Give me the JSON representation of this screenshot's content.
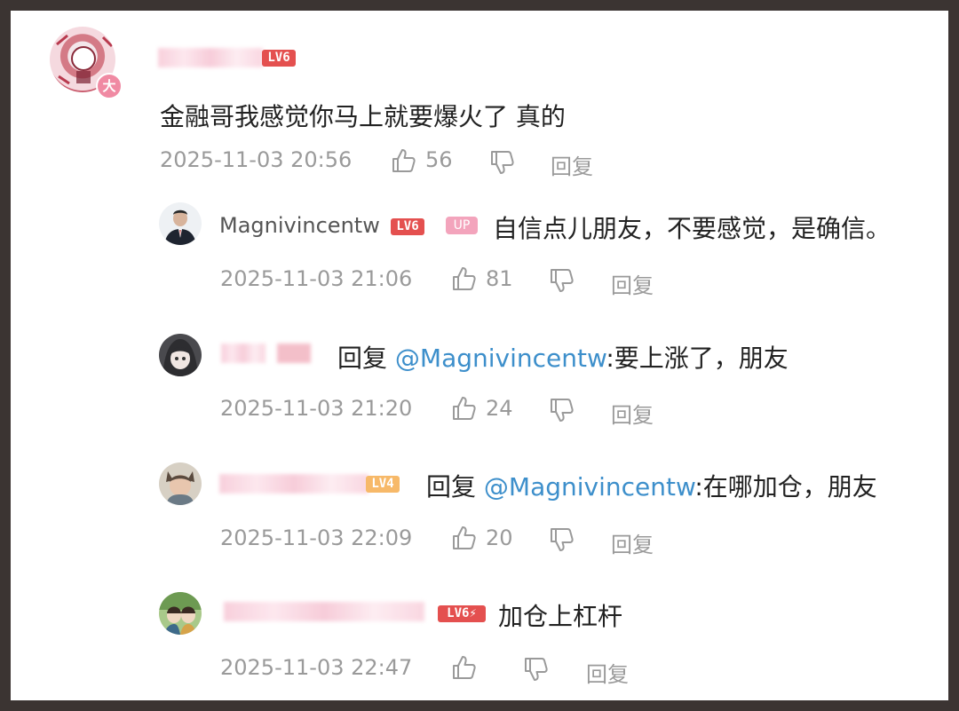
{
  "comment": {
    "level": "LV6",
    "text": "金融哥我感觉你马上就要爆火了 真的",
    "time": "2025-11-03 20:56",
    "likes": "56",
    "reply_label": "回复",
    "badge": "大"
  },
  "replies": [
    {
      "username": "Magnivincentw",
      "level": "LV6",
      "up_badge": "UP",
      "text": "自信点儿朋友，不要感觉，是确信。",
      "time": "2025-11-03 21:06",
      "likes": "81",
      "reply_label": "回复"
    },
    {
      "reply_word": "回复",
      "mention": "@Magnivincentw",
      "text": ":要上涨了，朋友",
      "time": "2025-11-03 21:20",
      "likes": "24",
      "reply_label": "回复"
    },
    {
      "level": "LV4",
      "reply_word": "回复",
      "mention": "@Magnivincentw",
      "text": ":在哪加仓，朋友",
      "time": "2025-11-03 22:09",
      "likes": "20",
      "reply_label": "回复"
    },
    {
      "level": "LV6⚡",
      "text": "加仓上杠杆",
      "time": "2025-11-03 22:47",
      "likes": "",
      "reply_label": "回复"
    }
  ],
  "colors": {
    "mention": "#3d8fcb",
    "level6": "#e4504f",
    "level4": "#f7b969",
    "up_badge": "#f3a4bc",
    "meta_text": "#9a9a9a"
  },
  "icons": [
    "thumbs-up-icon",
    "thumbs-down-icon"
  ]
}
